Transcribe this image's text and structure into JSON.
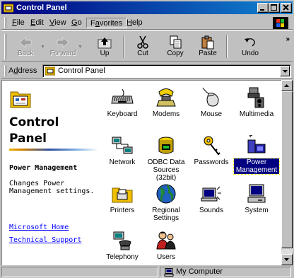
{
  "window": {
    "title": "Control Panel"
  },
  "menubar": {
    "items": [
      {
        "label": "File",
        "u": "F",
        "rest": "ile"
      },
      {
        "label": "Edit",
        "u": "E",
        "rest": "dit"
      },
      {
        "label": "View",
        "u": "V",
        "rest": "iew"
      },
      {
        "label": "Go",
        "u": "G",
        "rest": "o"
      },
      {
        "label": "Favorites",
        "u": "a",
        "pre": "F",
        "rest": "vorites"
      },
      {
        "label": "Help",
        "u": "H",
        "rest": "elp"
      }
    ]
  },
  "toolbar": {
    "back": "Back",
    "forward": "Forward",
    "up": "Up",
    "cut": "Cut",
    "copy": "Copy",
    "paste": "Paste",
    "undo": "Undo",
    "more": "»"
  },
  "address": {
    "label_u": "d",
    "label_pre": "A",
    "label_rest": "dress",
    "value": "Control Panel"
  },
  "leftpane": {
    "title": "Control Panel",
    "selected_name": "Power Management",
    "selected_desc": "Changes Power Management settings.",
    "links": [
      "Microsoft Home",
      "Technical Support"
    ]
  },
  "items": [
    {
      "label": "Keyboard",
      "icon": "keyboard-icon"
    },
    {
      "label": "Modems",
      "icon": "modem-icon"
    },
    {
      "label": "Mouse",
      "icon": "mouse-icon"
    },
    {
      "label": "Multimedia",
      "icon": "multimedia-icon"
    },
    {
      "label": "Network",
      "icon": "network-icon"
    },
    {
      "label": "ODBC Data Sources (32bit)",
      "icon": "odbc-icon"
    },
    {
      "label": "Passwords",
      "icon": "keys-icon"
    },
    {
      "label": "Power Management",
      "icon": "power-icon",
      "selected": true
    },
    {
      "label": "Printers",
      "icon": "printer-folder-icon"
    },
    {
      "label": "Regional Settings",
      "icon": "globe-icon"
    },
    {
      "label": "Sounds",
      "icon": "sounds-icon"
    },
    {
      "label": "System",
      "icon": "computer-icon"
    },
    {
      "label": "Telephony",
      "icon": "telephony-icon"
    },
    {
      "label": "Users",
      "icon": "users-icon"
    }
  ],
  "statusbar": {
    "location": "My Computer"
  },
  "colors": {
    "title_start": "#000080",
    "title_end": "#1084d0",
    "selection": "#000080",
    "link": "#0000ff"
  }
}
